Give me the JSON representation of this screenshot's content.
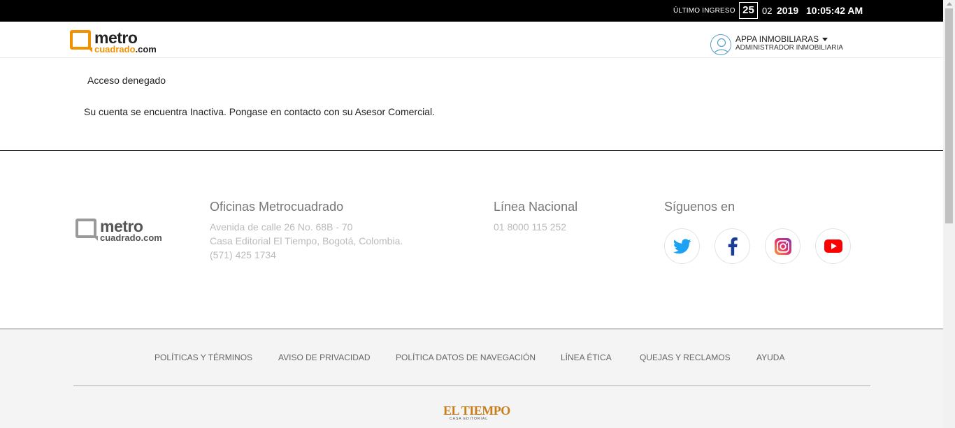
{
  "topbar": {
    "label": "ÚLTIMO INGRESO",
    "day": "25",
    "month": "02",
    "year": "2019",
    "time": "10:05:42 AM"
  },
  "header": {
    "logo": {
      "metro": "metro",
      "cuadrado": "cuadrado",
      "com": ".com"
    },
    "user": {
      "name": "APPA INMOBILIARAS",
      "role": "ADMINISTRADOR INMOBILIARIA"
    }
  },
  "main": {
    "title": "Acceso denegado",
    "message": "Su cuenta se encuentra Inactiva. Pongase en contacto con su Asesor Comercial."
  },
  "footer": {
    "logo": {
      "metro": "metro",
      "cuadrado": "cuadrado",
      "com": ".com"
    },
    "offices": {
      "title": "Oficinas Metrocuadrado",
      "line1": "Avenida de calle 26 No. 68B - 70",
      "line2": "Casa Editorial El Tiempo, Bogotá, Colombia.",
      "line3": "(571) 425 1734"
    },
    "national": {
      "title": "Línea Nacional",
      "phone": "01 8000 115 252"
    },
    "social": {
      "title": "Síguenos en",
      "icons": [
        "twitter-icon",
        "facebook-icon",
        "instagram-icon",
        "youtube-icon"
      ]
    },
    "links": [
      "POLÍTICAS Y TÉRMINOS",
      "AVISO DE PRIVACIDAD",
      "POLÍTICA DATOS DE NAVEGACIÓN",
      "LÍNEA ÉTICA",
      "QUEJAS Y RECLAMOS",
      "AYUDA"
    ],
    "brand": "EL TIEMPO",
    "brand_sub": "CASA EDITORIAL"
  },
  "colors": {
    "accent": "#f39200",
    "topbar": "#000000",
    "brand": "#c87f1b"
  }
}
